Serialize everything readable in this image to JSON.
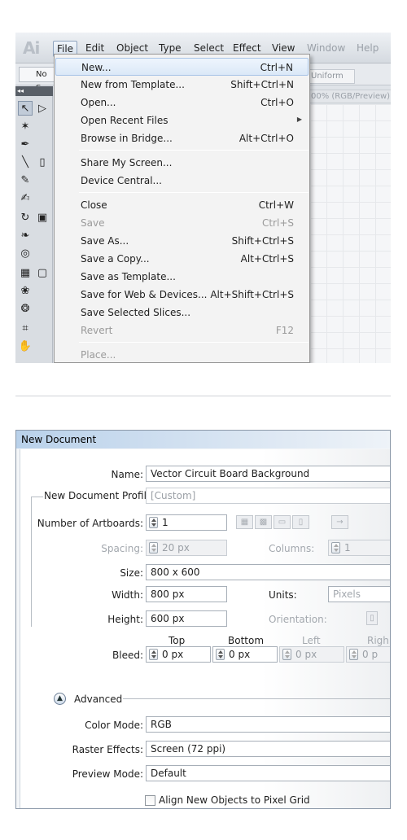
{
  "app_logo": "Ai",
  "menubar": {
    "items": [
      "File",
      "Edit",
      "Object",
      "Type",
      "Select",
      "Effect",
      "View",
      "Window",
      "Help"
    ],
    "active": "File"
  },
  "control_bar": {
    "no_selection": "No S",
    "uniform": "Uniform",
    "doc_tab": "00% (RGB/Preview)"
  },
  "file_menu": {
    "items": [
      {
        "label": "New...",
        "shortcut": "Ctrl+N",
        "highlighted": true
      },
      {
        "label": "New from Template...",
        "shortcut": "Shift+Ctrl+N"
      },
      {
        "label": "Open...",
        "shortcut": "Ctrl+O"
      },
      {
        "label": "Open Recent Files",
        "shortcut": ""
      },
      {
        "label": "Browse in Bridge...",
        "shortcut": "Alt+Ctrl+O"
      },
      {
        "label": "Share My Screen...",
        "shortcut": ""
      },
      {
        "label": "Device Central...",
        "shortcut": ""
      },
      {
        "label": "Close",
        "shortcut": "Ctrl+W"
      },
      {
        "label": "Save",
        "shortcut": "Ctrl+S",
        "disabled": true
      },
      {
        "label": "Save As...",
        "shortcut": "Shift+Ctrl+S"
      },
      {
        "label": "Save a Copy...",
        "shortcut": "Alt+Ctrl+S"
      },
      {
        "label": "Save as Template...",
        "shortcut": ""
      },
      {
        "label": "Save for Web & Devices...",
        "shortcut": "Alt+Shift+Ctrl+S"
      },
      {
        "label": "Save Selected Slices...",
        "shortcut": ""
      },
      {
        "label": "Revert",
        "shortcut": "F12",
        "disabled": true
      },
      {
        "label": "Place...",
        "shortcut": "",
        "disabled": true
      }
    ]
  },
  "new_document": {
    "title": "New Document",
    "name_label": "Name:",
    "name_value": "Vector Circuit Board Background",
    "profile_label": "New Document Profile:",
    "profile_value": "[Custom]",
    "artboards_label": "Number of Artboards:",
    "artboards_value": "1",
    "spacing_label": "Spacing:",
    "spacing_value": "20 px",
    "columns_label": "Columns:",
    "columns_value": "1",
    "size_label": "Size:",
    "size_value": "800 x 600",
    "width_label": "Width:",
    "width_value": "800 px",
    "units_label": "Units:",
    "units_value": "Pixels",
    "height_label": "Height:",
    "height_value": "600 px",
    "orientation_label": "Orientation:",
    "bleed_label": "Bleed:",
    "bleed_headers": [
      "Top",
      "Bottom",
      "Left",
      "Righ"
    ],
    "bleed_values": [
      "0 px",
      "0 px",
      "0 px",
      "0 p"
    ],
    "advanced_label": "Advanced",
    "color_mode_label": "Color Mode:",
    "color_mode_value": "RGB",
    "raster_label": "Raster Effects:",
    "raster_value": "Screen (72 ppi)",
    "preview_label": "Preview Mode:",
    "preview_value": "Default",
    "align_label": "Align New Objects to Pixel Grid"
  }
}
